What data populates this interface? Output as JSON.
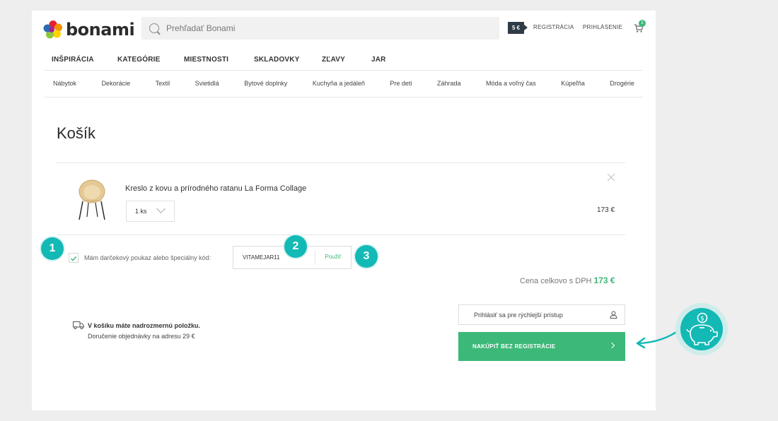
{
  "brand": {
    "name": "bonami"
  },
  "search": {
    "placeholder": "Prehľadať Bonami"
  },
  "header": {
    "credit_badge": "5 €",
    "register_label": "REGISTRÁCIA",
    "login_label": "PRIHLÁSENIE",
    "cart_count": "1"
  },
  "main_nav": [
    "INŠPIRÁCIA",
    "KATEGÓRIE",
    "MIESTNOSTI",
    "SKLADOVKY",
    "ZĽAVY",
    "JAR"
  ],
  "category_nav": [
    "Nábytok",
    "Dekorácie",
    "Textil",
    "Svietidlá",
    "Bytové doplnky",
    "Kuchyňa a jedáleň",
    "Pre deti",
    "Záhrada",
    "Móda a voľný čas",
    "Kúpeľňa",
    "Drogérie"
  ],
  "page_title": "Košík",
  "cart_item": {
    "name": "Kreslo z kovu a prírodného ratanu La Forma Collage",
    "quantity": "1 ks",
    "price": "173 €"
  },
  "coupon": {
    "checked": true,
    "label": "Mám darčekový poukaz alebo špeciálny kód:",
    "code": "VITAMEJAR11",
    "apply_label": "Použiť"
  },
  "steps": [
    "1",
    "2",
    "3"
  ],
  "total": {
    "label": "Cena celkovo s DPH",
    "value": "173 €"
  },
  "oversize": {
    "title": "V košíku máte nadrozmernú položku.",
    "text": "Doručenie objednávky na adresu 29 €"
  },
  "actions": {
    "login_label": "Prihlásiť sa pre rýchlejší prístup",
    "checkout_label": "NAKÚPIŤ BEZ REGISTRÁCIE"
  },
  "colors": {
    "accent_green": "#3cb878",
    "step_teal": "#13b9b5",
    "credit_badge": "#2f3b46",
    "background": "#eeeeee"
  }
}
